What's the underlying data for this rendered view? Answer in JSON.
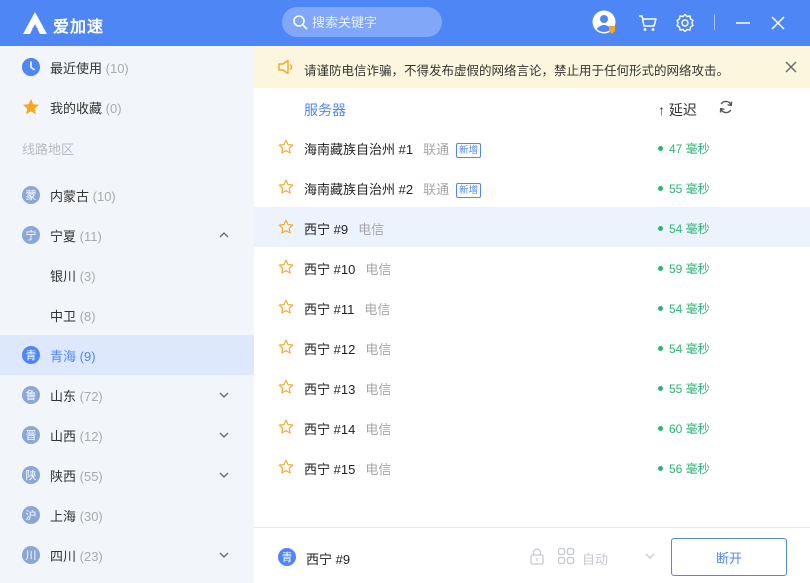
{
  "app": {
    "name": "爱加速"
  },
  "search": {
    "placeholder": "搜索关键字"
  },
  "sidebar": {
    "recent": {
      "label": "最近使用",
      "count": "(10)"
    },
    "favorites": {
      "label": "我的收藏",
      "count": "(0)"
    },
    "section_title": "线路地区",
    "regions": [
      {
        "badge": "蒙",
        "label": "内蒙古",
        "count": "(10)"
      },
      {
        "badge": "宁",
        "label": "宁夏",
        "count": "(11)"
      },
      {
        "label": "银川",
        "count": "(3)"
      },
      {
        "label": "中卫",
        "count": "(8)"
      },
      {
        "badge": "青",
        "label": "青海",
        "count": "(9)"
      },
      {
        "badge": "鲁",
        "label": "山东",
        "count": "(72)"
      },
      {
        "badge": "晋",
        "label": "山西",
        "count": "(12)"
      },
      {
        "badge": "陕",
        "label": "陕西",
        "count": "(55)"
      },
      {
        "badge": "沪",
        "label": "上海",
        "count": "(30)"
      },
      {
        "badge": "川",
        "label": "四川",
        "count": "(23)"
      }
    ]
  },
  "notice": {
    "text": "请谨防电信诈骗，不得发布虚假的网络言论，禁止用于任何形式的网络攻击。"
  },
  "table": {
    "col_server": "服务器",
    "col_latency": "↑ 延迟",
    "rows": [
      {
        "name": "海南藏族自治州 #1",
        "isp": "联通",
        "tag": "新增",
        "latency": "47 毫秒"
      },
      {
        "name": "海南藏族自治州 #2",
        "isp": "联通",
        "tag": "新增",
        "latency": "55 毫秒"
      },
      {
        "name": "西宁 #9",
        "isp": "电信",
        "latency": "54 毫秒"
      },
      {
        "name": "西宁 #10",
        "isp": "电信",
        "latency": "59 毫秒"
      },
      {
        "name": "西宁 #11",
        "isp": "电信",
        "latency": "54 毫秒"
      },
      {
        "name": "西宁 #12",
        "isp": "电信",
        "latency": "54 毫秒"
      },
      {
        "name": "西宁 #13",
        "isp": "电信",
        "latency": "55 毫秒"
      },
      {
        "name": "西宁 #14",
        "isp": "电信",
        "latency": "60 毫秒"
      },
      {
        "name": "西宁 #15",
        "isp": "电信",
        "latency": "56 毫秒"
      }
    ]
  },
  "footer": {
    "badge": "青",
    "server": "西宁 #9",
    "mode": "自动",
    "disconnect_label": "断开"
  },
  "colors": {
    "brand": "#4f86f5",
    "latency_good": "#2bb673",
    "notice_bg": "#fdf6de"
  }
}
